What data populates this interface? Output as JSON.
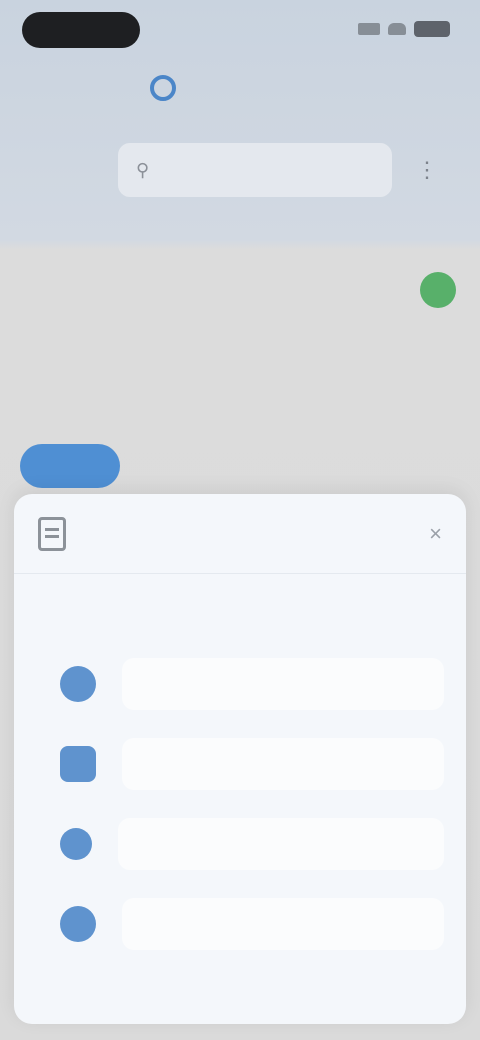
{
  "status_bar": {
    "time": "",
    "icons": [
      "signal-icon",
      "wifi-icon",
      "battery-icon"
    ]
  },
  "header": {
    "logo_text": "",
    "nav_left": "",
    "search": {
      "value": "",
      "placeholder": ""
    },
    "menu_icon": "hamburger-icon"
  },
  "actions": {
    "primary": "",
    "secondary": ""
  },
  "content": {
    "description": "",
    "button_label": ""
  },
  "sheet": {
    "title": "",
    "subtitle": "",
    "close_icon": "close-icon",
    "section_title": "",
    "items": [
      {
        "label": "",
        "icon": "share-icon"
      },
      {
        "label": "",
        "icon": "mail-icon"
      },
      {
        "label": "",
        "icon": "messages-icon"
      },
      {
        "label": "",
        "icon": "more-icon"
      }
    ]
  },
  "colors": {
    "accent": "#4f8fd3",
    "green": "#58b06a",
    "sheet_bg": "#f4f7fb"
  }
}
